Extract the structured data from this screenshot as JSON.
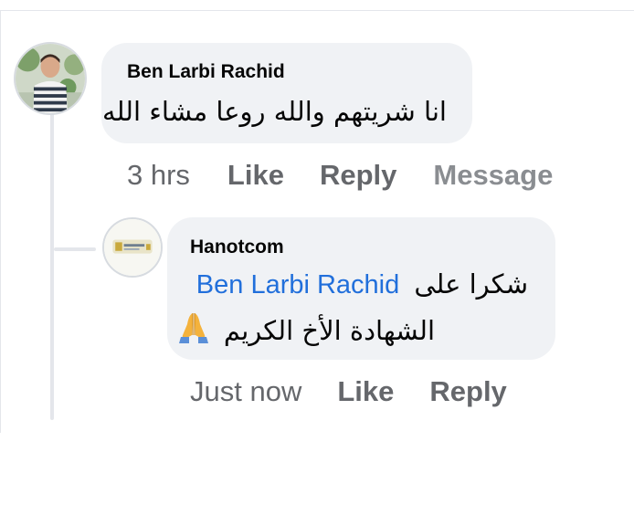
{
  "comment": {
    "author": "Ben Larbi Rachid",
    "text": "انا شريتهم والله روعا مشاء الله",
    "time": "3 hrs",
    "like_label": "Like",
    "reply_label": "Reply",
    "message_label": "Message"
  },
  "reply": {
    "author": "Hanotcom",
    "mention": "Ben Larbi Rachid",
    "text_line1": "شكرا على",
    "text_line2": "الشهادة الأخ الكريم",
    "emoji": "folded-hands-icon",
    "time": "Just now",
    "like_label": "Like",
    "reply_label": "Reply"
  },
  "colors": {
    "bubble": "#f0f2f5",
    "mention": "#216fdb",
    "action_text": "#65676b",
    "thread_line": "#e4e6eb"
  }
}
